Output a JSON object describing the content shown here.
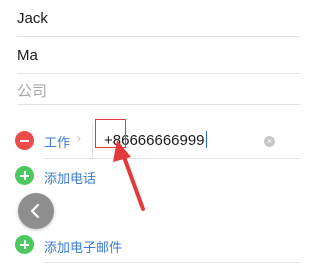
{
  "contact": {
    "first_name": "Jack",
    "last_name": "Ma",
    "company_placeholder": "公司"
  },
  "phone": {
    "label": "工作",
    "chevron": "›",
    "value": "+86666666999",
    "clear_symbol": "×"
  },
  "actions": {
    "add_phone": "添加电话",
    "add_email": "添加电子邮件"
  },
  "icons": {
    "remove": "minus-circle-icon",
    "add": "plus-circle-icon",
    "back": "chevron-left-icon",
    "clear": "clear-circle-icon"
  },
  "colors": {
    "accent_blue": "#3a7bd5",
    "remove_red": "#ee4b4b",
    "add_green": "#4cc85f",
    "annotation_red": "#e23a3a"
  }
}
